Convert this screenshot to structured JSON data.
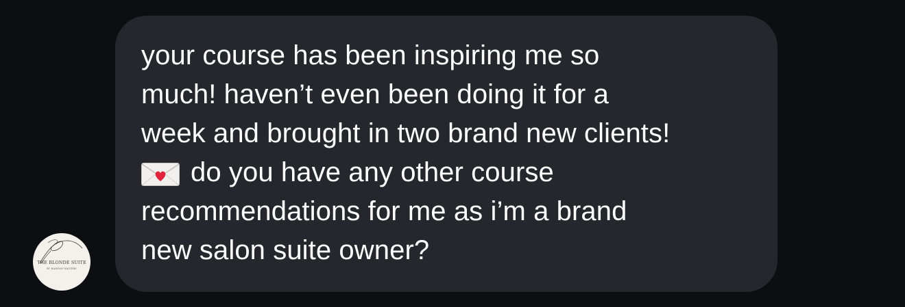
{
  "conversation": {
    "avatar": {
      "brand_name": "THE BLONDE SUITE",
      "brand_sub": "BY HANNAH WALTERS"
    },
    "message": {
      "line1": "your course has been inspiring me so",
      "line2": "much! haven’t even been doing it for a",
      "line3": "week and brought in two brand new clients!",
      "line4": "do you have any other course",
      "line5": "recommendations for me as i’m a brand",
      "line6": "new salon suite owner?",
      "emoji_icon": "love-letter-emoji"
    }
  },
  "colors": {
    "background": "#0c0e12",
    "bubble": "#25272c",
    "text": "#ffffff",
    "heart": "#e0243b"
  }
}
